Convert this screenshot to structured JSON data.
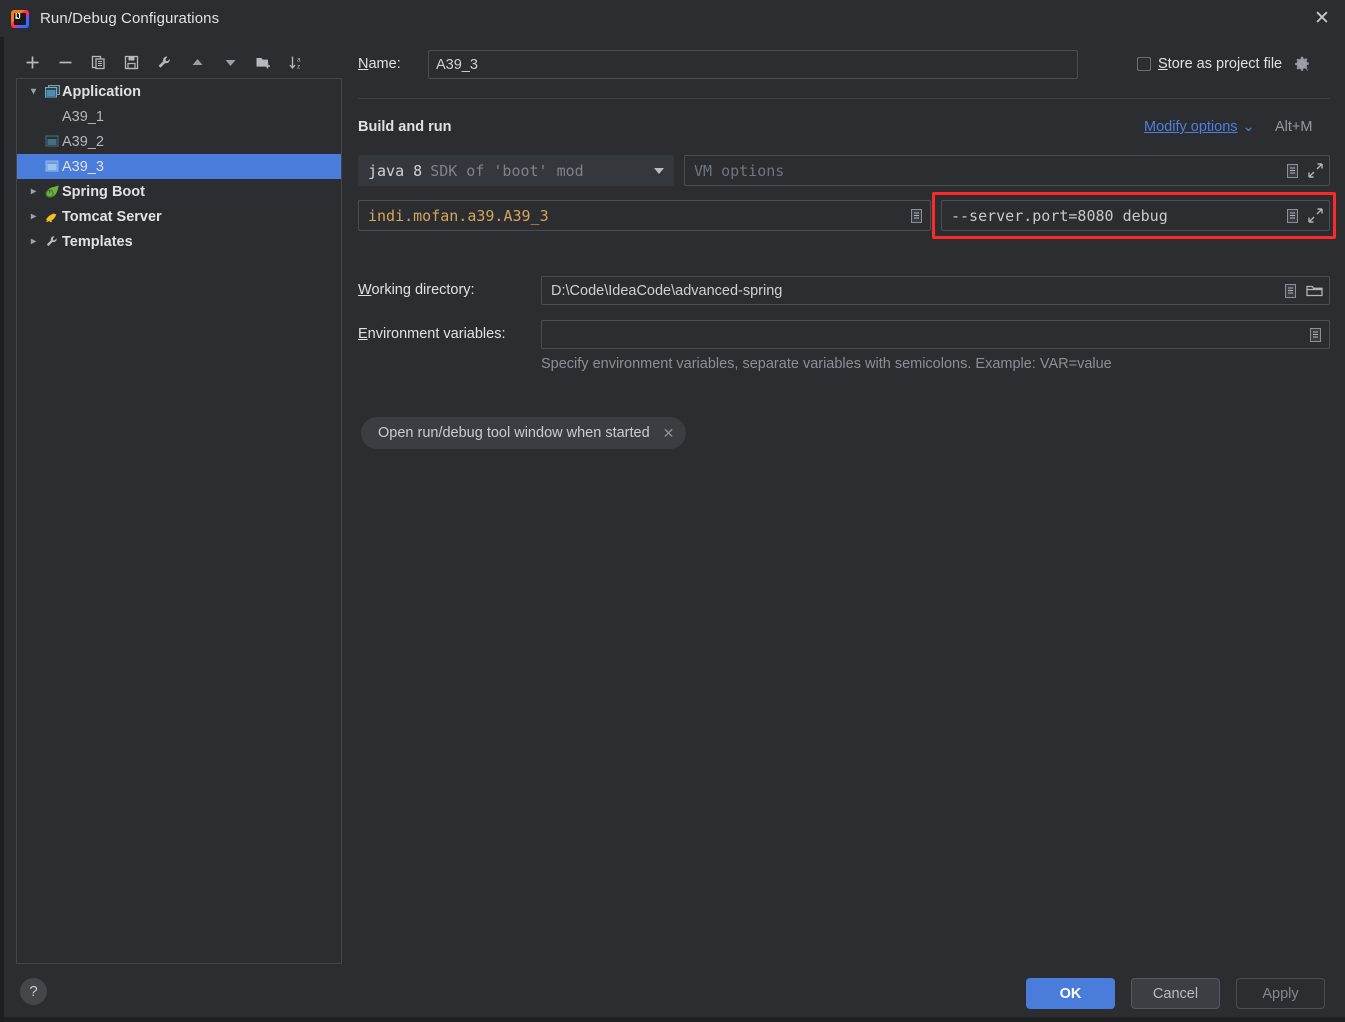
{
  "window": {
    "title": "Run/Debug Configurations",
    "app_icon": "intellij-idea-icon",
    "close_label": "✕"
  },
  "toolbar": {
    "buttons": [
      {
        "name": "add-configuration-button",
        "icon": "plus-icon"
      },
      {
        "name": "remove-configuration-button",
        "icon": "minus-icon"
      },
      {
        "name": "copy-configuration-button",
        "icon": "copy-icon"
      },
      {
        "name": "save-configuration-button",
        "icon": "save-icon"
      },
      {
        "name": "edit-templates-button",
        "icon": "wrench-icon"
      },
      {
        "name": "move-up-button",
        "icon": "arrow-up-icon"
      },
      {
        "name": "move-down-button",
        "icon": "arrow-down-icon"
      },
      {
        "name": "new-folder-button",
        "icon": "folder-add-icon"
      },
      {
        "name": "sort-alphabetically-button",
        "icon": "sort-az-icon"
      }
    ]
  },
  "tree": {
    "items": [
      {
        "label": "Application",
        "level": 0,
        "twisty": "expanded",
        "icon": "application-icon",
        "selected": false,
        "bold": true
      },
      {
        "label": "A39_1",
        "level": 1,
        "twisty": "none",
        "icon": "none",
        "selected": false,
        "bold": false
      },
      {
        "label": "A39_2",
        "level": 1,
        "twisty": "none",
        "icon": "application-icon",
        "selected": false,
        "bold": false
      },
      {
        "label": "A39_3",
        "level": 1,
        "twisty": "none",
        "icon": "application-icon",
        "selected": true,
        "bold": false
      },
      {
        "label": "Spring Boot",
        "level": 0,
        "twisty": "collapsed",
        "icon": "spring-boot-icon",
        "selected": false,
        "bold": true
      },
      {
        "label": "Tomcat Server",
        "level": 0,
        "twisty": "collapsed",
        "icon": "tomcat-icon",
        "selected": false,
        "bold": true
      },
      {
        "label": "Templates",
        "level": 0,
        "twisty": "collapsed",
        "icon": "wrench-icon",
        "selected": false,
        "bold": true
      }
    ]
  },
  "form": {
    "name_label": "Name:",
    "name_value": "A39_3",
    "store_as_project_file_label": "Store as project file",
    "store_as_project_file_checked": false,
    "store_gear_icon": "gear-icon",
    "section_title": "Build and run",
    "modify_options_label": "Modify options",
    "modify_options_shortcut": "Alt+M",
    "sdk_value": "java 8",
    "sdk_hint": "SDK of 'boot' mod",
    "vm_options_placeholder": "VM options",
    "vm_options_value": "",
    "main_class_value": "indi.mofan.a39.A39_3",
    "program_arguments_value": "--server.port=8080 debug",
    "working_directory_label": "Working directory:",
    "working_directory_value": "D:\\Code\\IdeaCode\\advanced-spring",
    "environment_variables_label": "Environment variables:",
    "environment_variables_value": "",
    "environment_hint": "Specify environment variables, separate variables with semicolons. Example: VAR=value",
    "chip_label": "Open run/debug tool window when started",
    "chip_close_icon": "close-icon",
    "expand_icon": "expand-icon",
    "editor_icon": "expand-editor-icon",
    "browse_icon": "folder-browse-icon",
    "highlight_color": "#fc2b29"
  },
  "footer": {
    "help_label": "?",
    "ok_label": "OK",
    "cancel_label": "Cancel",
    "apply_label": "Apply",
    "ok_color": "#4a7ddb"
  }
}
